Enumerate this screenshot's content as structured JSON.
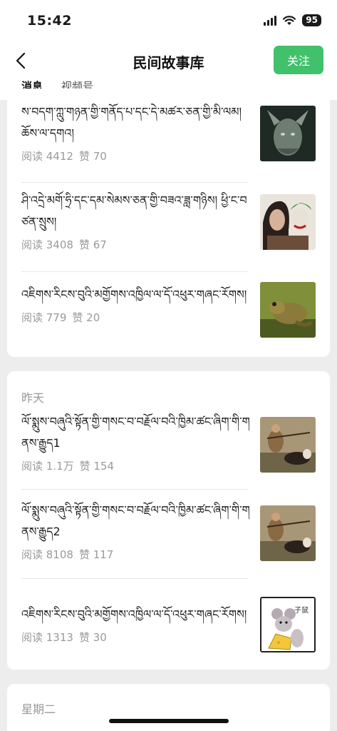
{
  "status_bar": {
    "time": "15:42",
    "battery": "95"
  },
  "header": {
    "title": "民间故事库",
    "follow_label": "关注",
    "tabs": [
      {
        "label": "消息",
        "active": true
      },
      {
        "label": "视频号",
        "active": false
      }
    ]
  },
  "groups": [
    {
      "day_label": "",
      "items": [
        {
          "title": "ས་བདག་ཀླུ་གཉན་གྱི་གནོད་པ་དང་དེ་མཚར་ཅན་གྱི་མི་ལམ། ཆོས་ལ་དགའ།",
          "reads_label": "阅读 4412",
          "likes_label": "赞 70",
          "thumb": "dragon-portrait"
        },
        {
          "title": "ཤི་འདྲེ་མགོ་ཧྲི་དང་དམ་སེམས་ཅན་གྱི་བཟའ་ཟླ་གཉིས།    ཕྱི་ང་བཙན་སྲུས།",
          "reads_label": "阅读 3408",
          "likes_label": "赞 67",
          "thumb": "two-faces"
        },
        {
          "title": "འཇིགས་རིངས་བུའི་མགྱོགས་འཁྱིལ་ལ་དོ་འཕུར་གཞང་རོགས།",
          "reads_label": "阅读 779",
          "likes_label": "赞 20",
          "thumb": "frog"
        }
      ]
    },
    {
      "day_label": "昨天",
      "items": [
        {
          "title": "ལོ་སྨུས་བཞུའི་སྟོན་གྱི་གསང་བ་བརྗོལ་བའི་ཁྱིམ་ཚང་ཞིག་གི་གནས་རྒྱུད1",
          "reads_label": "阅读 1.1万",
          "likes_label": "赞 154",
          "thumb": "hunter-dog"
        },
        {
          "title": "ལོ་སྨུས་བཞུའི་སྟོན་གྱི་གསང་བ་བརྗོལ་བའི་ཁྱིམ་ཚང་ཞིག་གི་གནས་རྒྱུད2",
          "reads_label": "阅读 8108",
          "likes_label": "赞 117",
          "thumb": "hunter-dog"
        },
        {
          "title": "འཇིགས་རིངས་བུའི་མགྱོགས་འཁྱིལ་ལ་དོ་འཕུར་གཞང་རོགས།",
          "reads_label": "阅读 1313",
          "likes_label": "赞 30",
          "thumb": "mouse-cheese",
          "thumb_text": "子鼠"
        }
      ]
    },
    {
      "day_label": "星期二",
      "items": []
    }
  ],
  "colors": {
    "accent": "#41c16b",
    "meta": "#9a9a9a",
    "background": "#ededed"
  }
}
